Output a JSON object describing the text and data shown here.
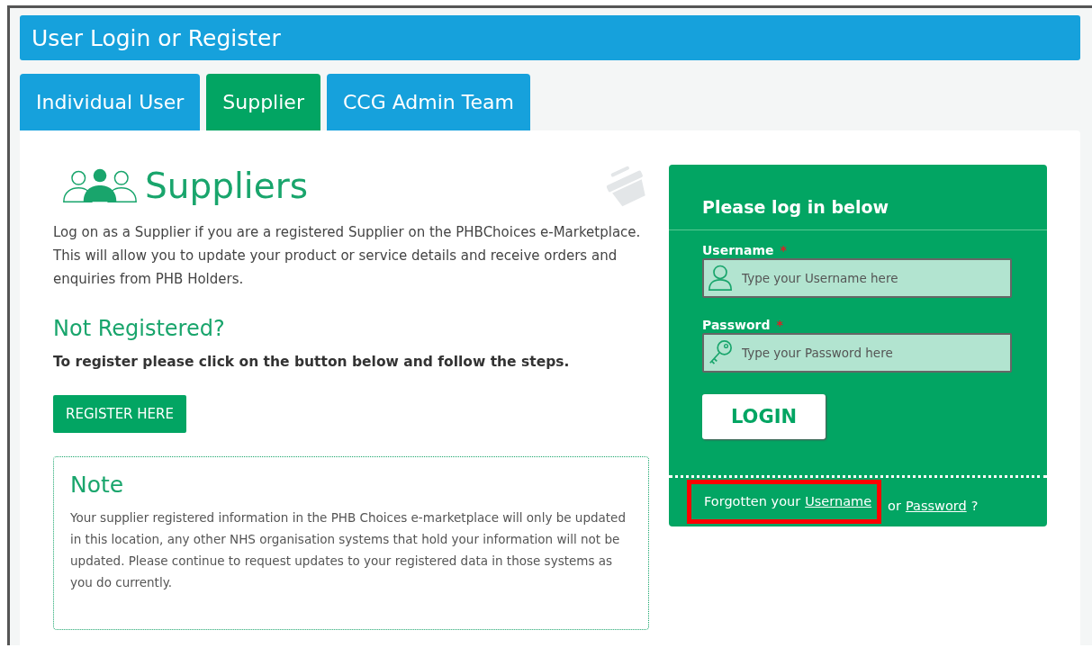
{
  "header": {
    "title": "User Login or Register"
  },
  "tabs": [
    {
      "label": "Individual User",
      "selected": false
    },
    {
      "label": "Supplier",
      "selected": true
    },
    {
      "label": "CCG Admin Team",
      "selected": false
    }
  ],
  "intro": {
    "title": "Suppliers",
    "text": "Log on as a Supplier if you are a registered Supplier on the PHBChoices e-Marketplace. This will allow you to update your product or service details and receive orders and enquiries from PHB Holders."
  },
  "register": {
    "title": "Not Registered?",
    "instruction": "To register please click on the button below and follow the steps.",
    "button": "REGISTER HERE"
  },
  "note": {
    "title": "Note",
    "text": "Your supplier registered information in the PHB Choices e-marketplace will only be updated in this location, any other NHS organisation systems that hold your information will not be updated. Please continue to request updates to your registered data in those systems as you do currently."
  },
  "login": {
    "title": "Please log in below",
    "fields": [
      {
        "kind": "user",
        "label": "Username",
        "required_mark": "*",
        "placeholder": "Type your Username here"
      },
      {
        "kind": "key",
        "label": "Password",
        "required_mark": "*",
        "placeholder": "Type your Password here"
      }
    ],
    "button": "LOGIN",
    "forgot": {
      "prefix": "Forgotten your",
      "link_1": "Username",
      "middle": "or",
      "link_2": "Password",
      "suffix": "?",
      "highlighted": true
    }
  }
}
